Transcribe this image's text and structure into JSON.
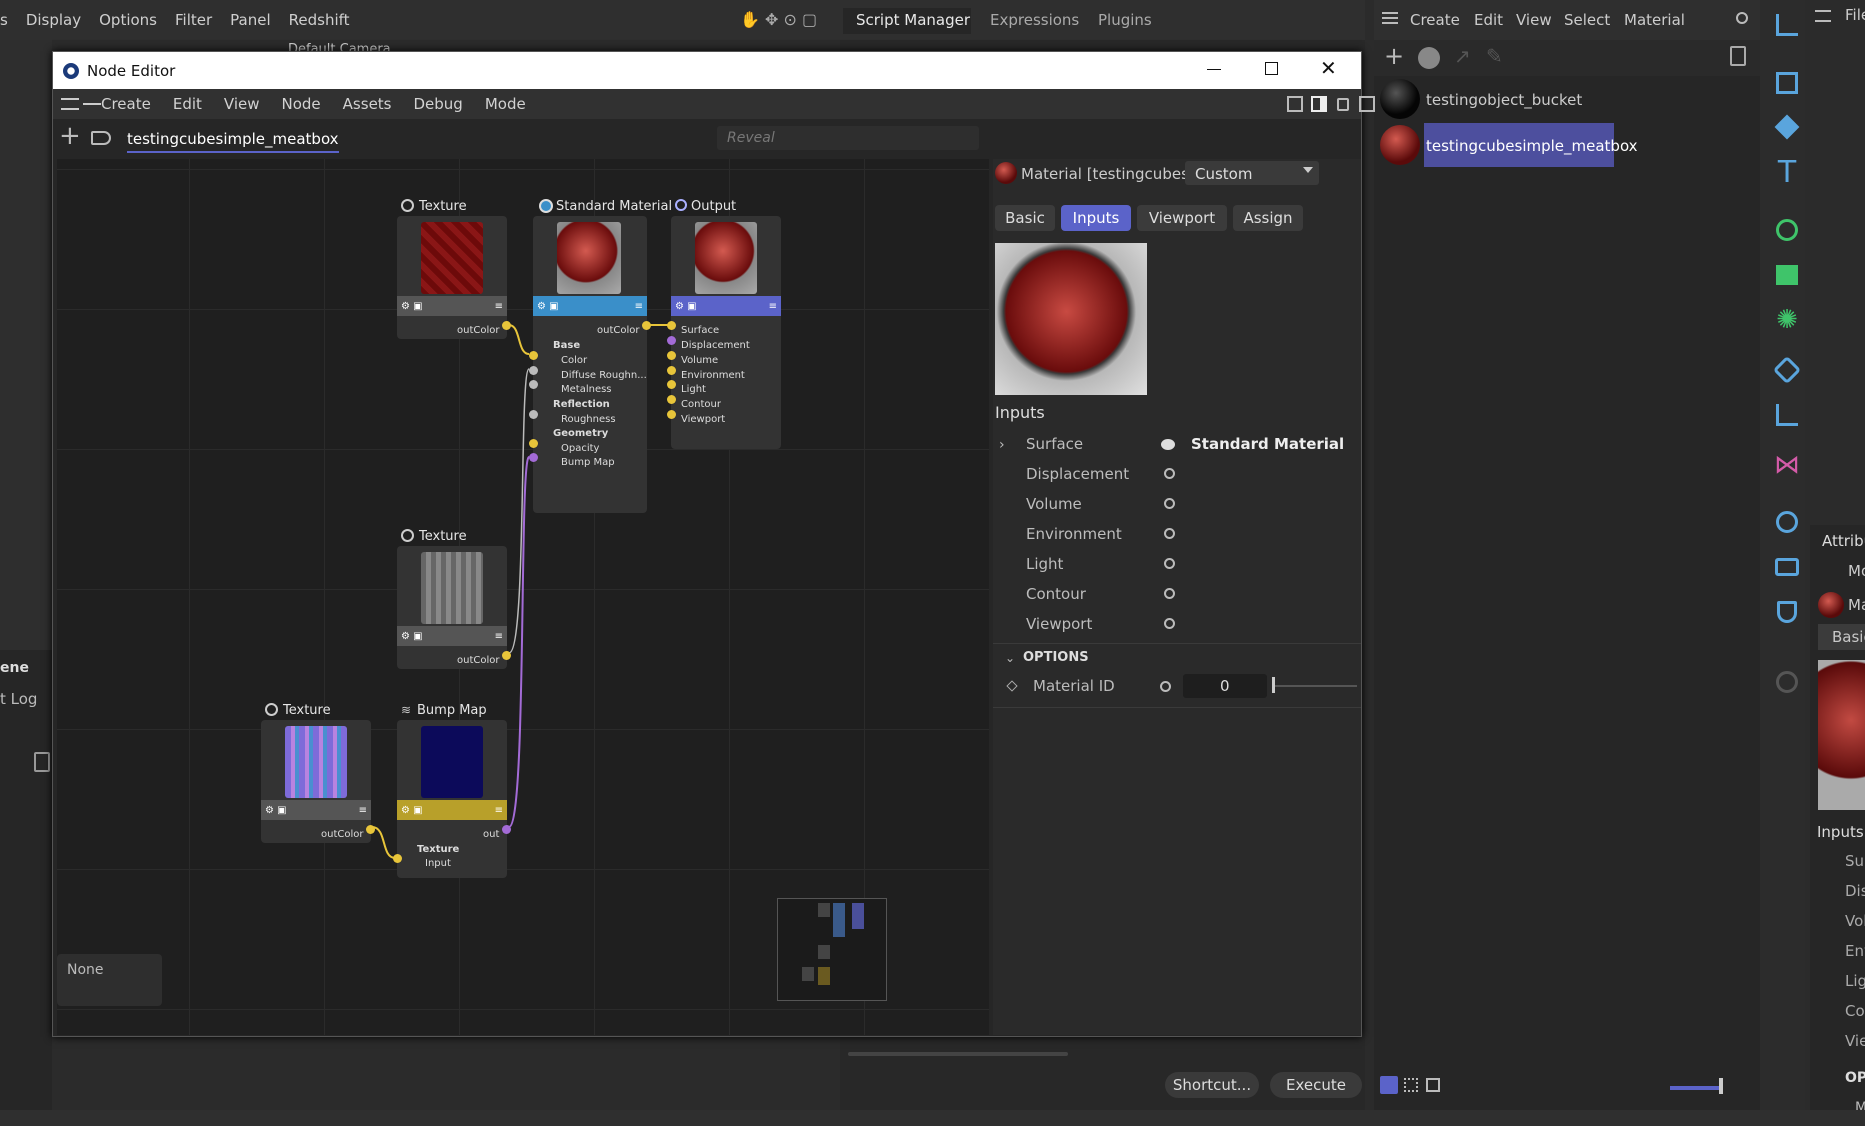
{
  "top_menu": {
    "items": [
      "s",
      "Display",
      "Options",
      "Filter",
      "Panel",
      "Redshift"
    ]
  },
  "viewport": {
    "camera_label": "Default Camera"
  },
  "script_manager": {
    "tabs": [
      "Script Manager",
      "Expressions",
      "Plugins"
    ],
    "menu": [
      "File",
      "Edit"
    ],
    "buttons": {
      "shortcut": "Shortcut...",
      "execute": "Execute"
    }
  },
  "left_panel": {
    "scene_label": "ene",
    "log_label": "t Log"
  },
  "material_manager": {
    "menu": [
      "Create",
      "Edit",
      "View",
      "Select",
      "Material"
    ],
    "materials": [
      {
        "name": "testingobject_bucket"
      },
      {
        "name": "testingcubesimple_meatbox",
        "selected": true
      }
    ]
  },
  "attributes": {
    "title": "Attribu",
    "mode": "Mo",
    "mat": "Ma",
    "basic": "Basic",
    "inputs": "Inputs",
    "rows": [
      "Sur",
      "Dis",
      "Vol",
      "Env",
      "Lig",
      "Co",
      "Vie"
    ],
    "options": "OP",
    "m": "M"
  },
  "file_label": "File",
  "node_editor": {
    "title": "Node Editor",
    "menu": [
      "Create",
      "Edit",
      "View",
      "Node",
      "Assets",
      "Debug",
      "Mode"
    ],
    "tab": "testingcubesimple_meatbox",
    "search_placeholder": "Reveal",
    "none_label": "None",
    "nodes": {
      "texture1": {
        "title": "Texture",
        "out": "outColor"
      },
      "standard": {
        "title": "Standard Material",
        "out": "outColor",
        "groups": [
          "Base",
          "Reflection",
          "Geometry"
        ],
        "ports": [
          "Color",
          "Diffuse Roughn...",
          "Metalness",
          "Roughness",
          "Opacity",
          "Bump Map"
        ]
      },
      "output": {
        "title": "Output",
        "ports": [
          "Surface",
          "Displacement",
          "Volume",
          "Environment",
          "Light",
          "Contour",
          "Viewport"
        ]
      },
      "texture2": {
        "title": "Texture",
        "out": "outColor"
      },
      "texture3": {
        "title": "Texture",
        "out": "outColor"
      },
      "bump": {
        "title": "Bump Map",
        "out": "out",
        "group": "Texture",
        "port": "Input"
      }
    },
    "props": {
      "material_title": "Material [testingcubesimpl...",
      "preset": "Custom",
      "tabs": [
        "Basic",
        "Inputs",
        "Viewport",
        "Assign"
      ],
      "active_tab": "Inputs",
      "inputs_heading": "Inputs",
      "inputs": [
        {
          "name": "Surface",
          "value": "Standard Material"
        },
        {
          "name": "Displacement"
        },
        {
          "name": "Volume"
        },
        {
          "name": "Environment"
        },
        {
          "name": "Light"
        },
        {
          "name": "Contour"
        },
        {
          "name": "Viewport"
        }
      ],
      "options_heading": "OPTIONS",
      "material_id_label": "Material ID",
      "material_id_value": "0"
    }
  },
  "colors": {
    "accent": "#5b63c9",
    "std_bar": "#3a8fc9",
    "output_bar": "#5b63c9",
    "bump_bar": "#b8a02a",
    "port_yellow": "#e8c53a",
    "port_purple": "#a36bd6"
  }
}
